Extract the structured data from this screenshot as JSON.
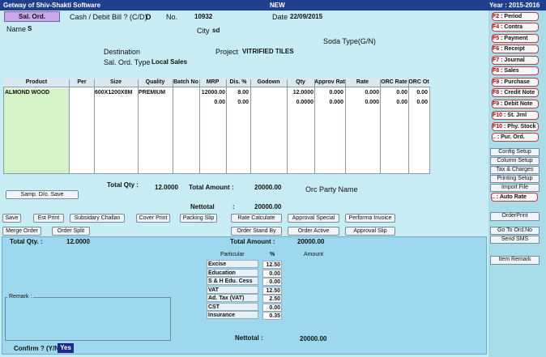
{
  "titlebar": {
    "app": "Getway of Shiv-Shakti Software",
    "mode": "NEW",
    "year": "Year : 2015-2016"
  },
  "header": {
    "sal_ord_label": "Sal. Ord.",
    "cash_debit_label": "Cash / Debit Bill ? (C/D)",
    "cash_debit_value": "D",
    "no_label": "No.",
    "no_value": "10932",
    "date_label": "Date",
    "date_value": "22/09/2015",
    "name_label": "Name",
    "name_value": "S",
    "city_label": "City",
    "city_value": "sd",
    "soda_type_label": "Soda Type(G/N)",
    "destination_label": "Destination",
    "project_label": "Project",
    "project_value": "VITRIFIED TILES",
    "sal_ord_type_label": "Sal. Ord. Type",
    "sal_ord_type_value": "Local Sales"
  },
  "grid": {
    "columns": [
      "Product",
      "Per",
      "Size",
      "Quality",
      "Batch No",
      "MRP",
      "Dis. %",
      "Godown",
      "Qty",
      "Approv Rat",
      "Rate",
      "ORC Rate",
      "ORC Ot"
    ],
    "rows": [
      {
        "product": "ALMOND WOOD",
        "size": "600X1200X8M",
        "quality": "PREMIUM",
        "mrp": "12000.00",
        "dis": "8.00",
        "qty": "12.0000",
        "approv": "0.000",
        "rate": "0.000",
        "orc_rate": "0.00",
        "orc_ot": "0.00"
      },
      {
        "product": "",
        "size": "",
        "quality": "",
        "mrp": "0.00",
        "dis": "0.00",
        "qty": "0.0000",
        "approv": "0.000",
        "rate": "0.000",
        "orc_rate": "0.00",
        "orc_ot": "0.00"
      }
    ]
  },
  "totals": {
    "total_qty_label": "Total Qty :",
    "total_qty_value": "12.0000",
    "total_amount_label": "Total Amount :",
    "total_amount_value": "20000.00",
    "orc_party_label": "Orc Party Name",
    "nettotal_label": "Nettotal",
    "nettotal_colon": ":",
    "nettotal_value": "20000.00"
  },
  "buttons": {
    "samp_do_save": "Samp. D/o. Save",
    "save": "Save",
    "est_print": "Est Print",
    "subsidary_challan": "Subsidary Challan",
    "cover_print": "Cover Print",
    "packing_slip": "Packing Slip",
    "rate_calculate": "Rate Calculate",
    "approval_special": "Approval Special",
    "performa_invoice": "Performa Invoice",
    "merge_order": "Merge Order",
    "order_split": "Order Split",
    "order_stand_by": "Order Stand By",
    "order_active": "Order Active",
    "approval_slip": "Approval Slip"
  },
  "bottom": {
    "total_qty_label": "Total Qty. :",
    "total_qty_value": "12.0000",
    "total_amount_label": "Total Amount :",
    "total_amount_value": "20000.00",
    "particular_header": "Particular",
    "percent_header": "%",
    "amount_header": "Amount",
    "taxes": [
      {
        "name": "Excise",
        "pct": "12.50"
      },
      {
        "name": "Education",
        "pct": "0.00"
      },
      {
        "name": "S & H Edu. Cess",
        "pct": "0.00"
      },
      {
        "name": "VAT",
        "pct": "12.50"
      },
      {
        "name": "Ad. Tax (VAT)",
        "pct": "2.50"
      },
      {
        "name": "CST",
        "pct": "0.00"
      },
      {
        "name": "Insurance",
        "pct": "0.35"
      }
    ],
    "remark_label": "Remark :",
    "nettotal_label": "Nettotal :",
    "nettotal_value": "20000.00",
    "confirm_label": "Confirm ? (Y/N)",
    "confirm_value": "Yes"
  },
  "fkeys": [
    {
      "key": "F2",
      "label": ": Period"
    },
    {
      "key": "F4",
      "label": ": Contra"
    },
    {
      "key": "F5",
      "label": ": Payment"
    },
    {
      "key": "F6",
      "label": ": Receipt"
    },
    {
      "key": "F7",
      "label": ": Journal"
    },
    {
      "key": "F8",
      "label": ": Sales"
    },
    {
      "key": "F9",
      "label": ": Purchase"
    },
    {
      "key": "F8",
      "label": ": Credit Note"
    },
    {
      "key": "F9",
      "label": ": Debit Note"
    },
    {
      "key": "F10",
      "label": ": St. Jrnl"
    },
    {
      "key": "F10",
      "label": ": Phy. Stock"
    },
    {
      "key": "..",
      "label": ": Pur. Ord."
    }
  ],
  "side_buttons": {
    "config_setup": "Config Setup",
    "column_setup": "Column Setup",
    "tax_charges": "Tax & Charges",
    "printing_setup": "Printing Setup",
    "import_file": "Import File",
    "auto_rate_key": "..",
    "auto_rate": ": Auto Rate",
    "order_print": "OrderPrint",
    "go_to_ord": "Go To Ord.No",
    "send_sms": "Send SMS",
    "item_remark": "Item Remark"
  }
}
